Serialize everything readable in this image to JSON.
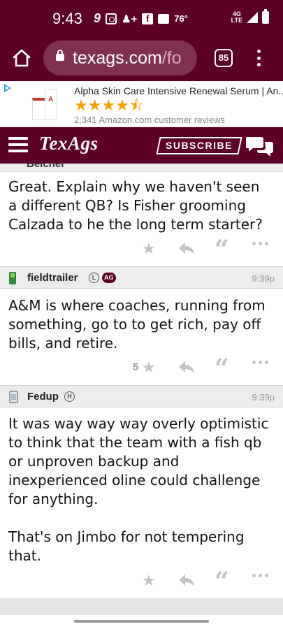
{
  "status_bar": {
    "time": "9:43",
    "temperature": "76°",
    "network_top": "4G",
    "network_bottom": "LTE"
  },
  "browser": {
    "url_main": "texags.com",
    "url_suffix": "/fo",
    "tab_count": "85"
  },
  "ad": {
    "title": "Alpha Skin Care Intensive Renewal Serum | An...",
    "stars": "★★★★⯪",
    "reviews": "2,341 Amazon.com customer reviews",
    "star_color": "#f0a202"
  },
  "site_header": {
    "logo": "TexAgs",
    "subscribe_label": "SUBSCRIBE",
    "brand_color": "#5c0025"
  },
  "posts": [
    {
      "username": "Belcher",
      "text": "Great. Explain why we haven't seen a different QB? Is Fisher grooming Calzada to he the long term starter?",
      "likes": "",
      "icon": "phone-icon"
    },
    {
      "username": "fieldtrailer",
      "badges": [
        "L",
        "AG"
      ],
      "time": "9:39p",
      "text": "A&M is where coaches, running from something, go to to get rich, pay off bills, and retire.",
      "likes": "5",
      "icon": "phone-icon"
    },
    {
      "username": "Fedup",
      "badges": [
        "H"
      ],
      "time": "9:39p",
      "text": "It was way way way overly optimistic to think that the team with a fish qb or unproven backup and inexperienced oline could challenge for anything.\n\nThat's on Jimbo for not tempering that.",
      "likes": "",
      "icon": "notepad-icon"
    }
  ]
}
